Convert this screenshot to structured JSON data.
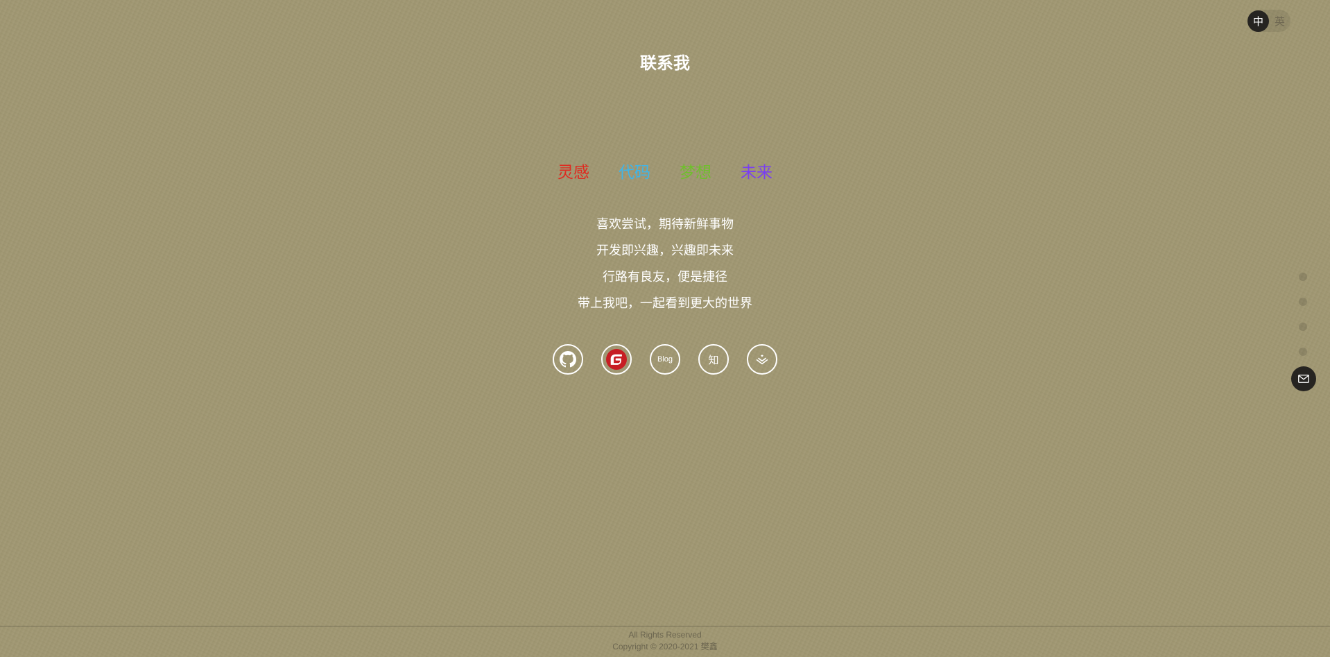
{
  "language": {
    "active": "中",
    "inactive": "英"
  },
  "title": "联系我",
  "keywords": [
    {
      "text": "灵感",
      "color": "#e0281e"
    },
    {
      "text": "代码",
      "color": "#3fb5e8"
    },
    {
      "text": "梦想",
      "color": "#6fbf2c"
    },
    {
      "text": "未来",
      "color": "#7a3ff0"
    }
  ],
  "lines": [
    "喜欢尝试，期待新鲜事物",
    "开发即兴趣，兴趣即未来",
    "行路有良友，便是捷径",
    "带上我吧，一起看到更大的世界"
  ],
  "socials": {
    "blog_label": "Blog",
    "zhihu_label": "知"
  },
  "footer": {
    "rights": "All Rights Reserved",
    "copyright": "Copyright © 2020-2021 樊鑫"
  },
  "colors": {
    "background": "#a09772",
    "accent_dark": "#262421",
    "gitee_red": "#c71d23"
  }
}
